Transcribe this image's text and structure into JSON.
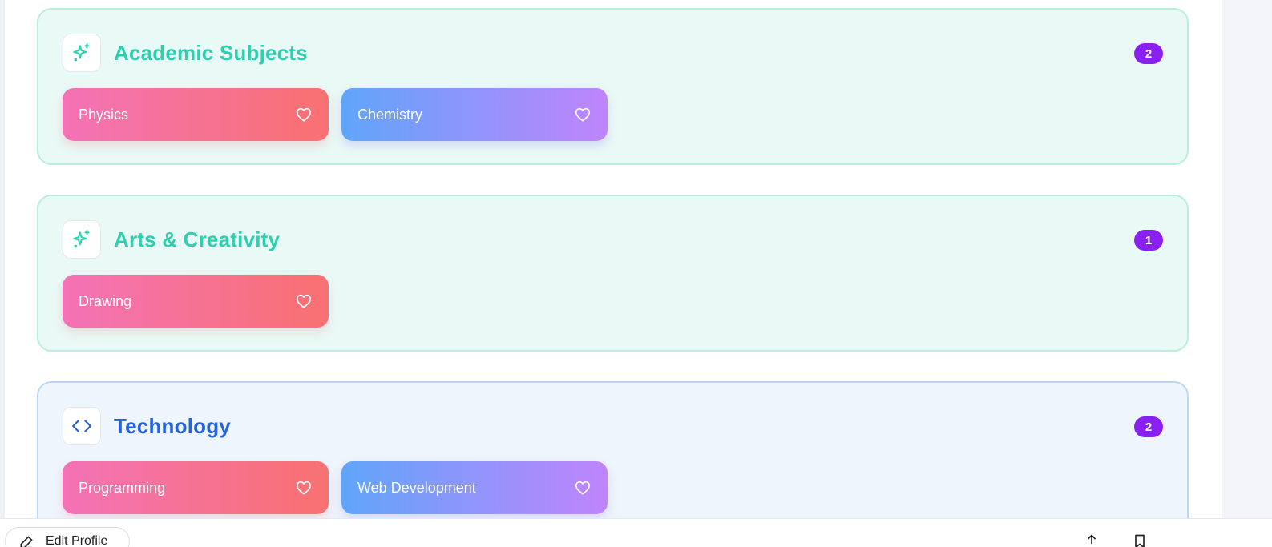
{
  "categories": [
    {
      "title": "Academic Subjects",
      "count": "2",
      "icon": "sparkles-icon",
      "items": [
        {
          "label": "Physics",
          "style": "pink"
        },
        {
          "label": "Chemistry",
          "style": "blue"
        }
      ]
    },
    {
      "title": "Arts & Creativity",
      "count": "1",
      "icon": "sparkles-icon",
      "items": [
        {
          "label": "Drawing",
          "style": "pink"
        }
      ]
    },
    {
      "title": "Technology",
      "count": "2",
      "icon": "code-icon",
      "items": [
        {
          "label": "Programming",
          "style": "pink"
        },
        {
          "label": "Web Development",
          "style": "blue"
        }
      ]
    }
  ],
  "footer": {
    "edit_label": "Edit Profile",
    "icons": [
      "edit-icon",
      "share-icon",
      "bookmark-icon"
    ]
  },
  "colors": {
    "teal_title": "#2dcfae",
    "blue_title": "#2563d6",
    "badge": "#8a1ff2",
    "pink_start": "#f472b6",
    "pink_end": "#f87171",
    "blue_start": "#60a5fa",
    "blue_end": "#c084fc"
  }
}
